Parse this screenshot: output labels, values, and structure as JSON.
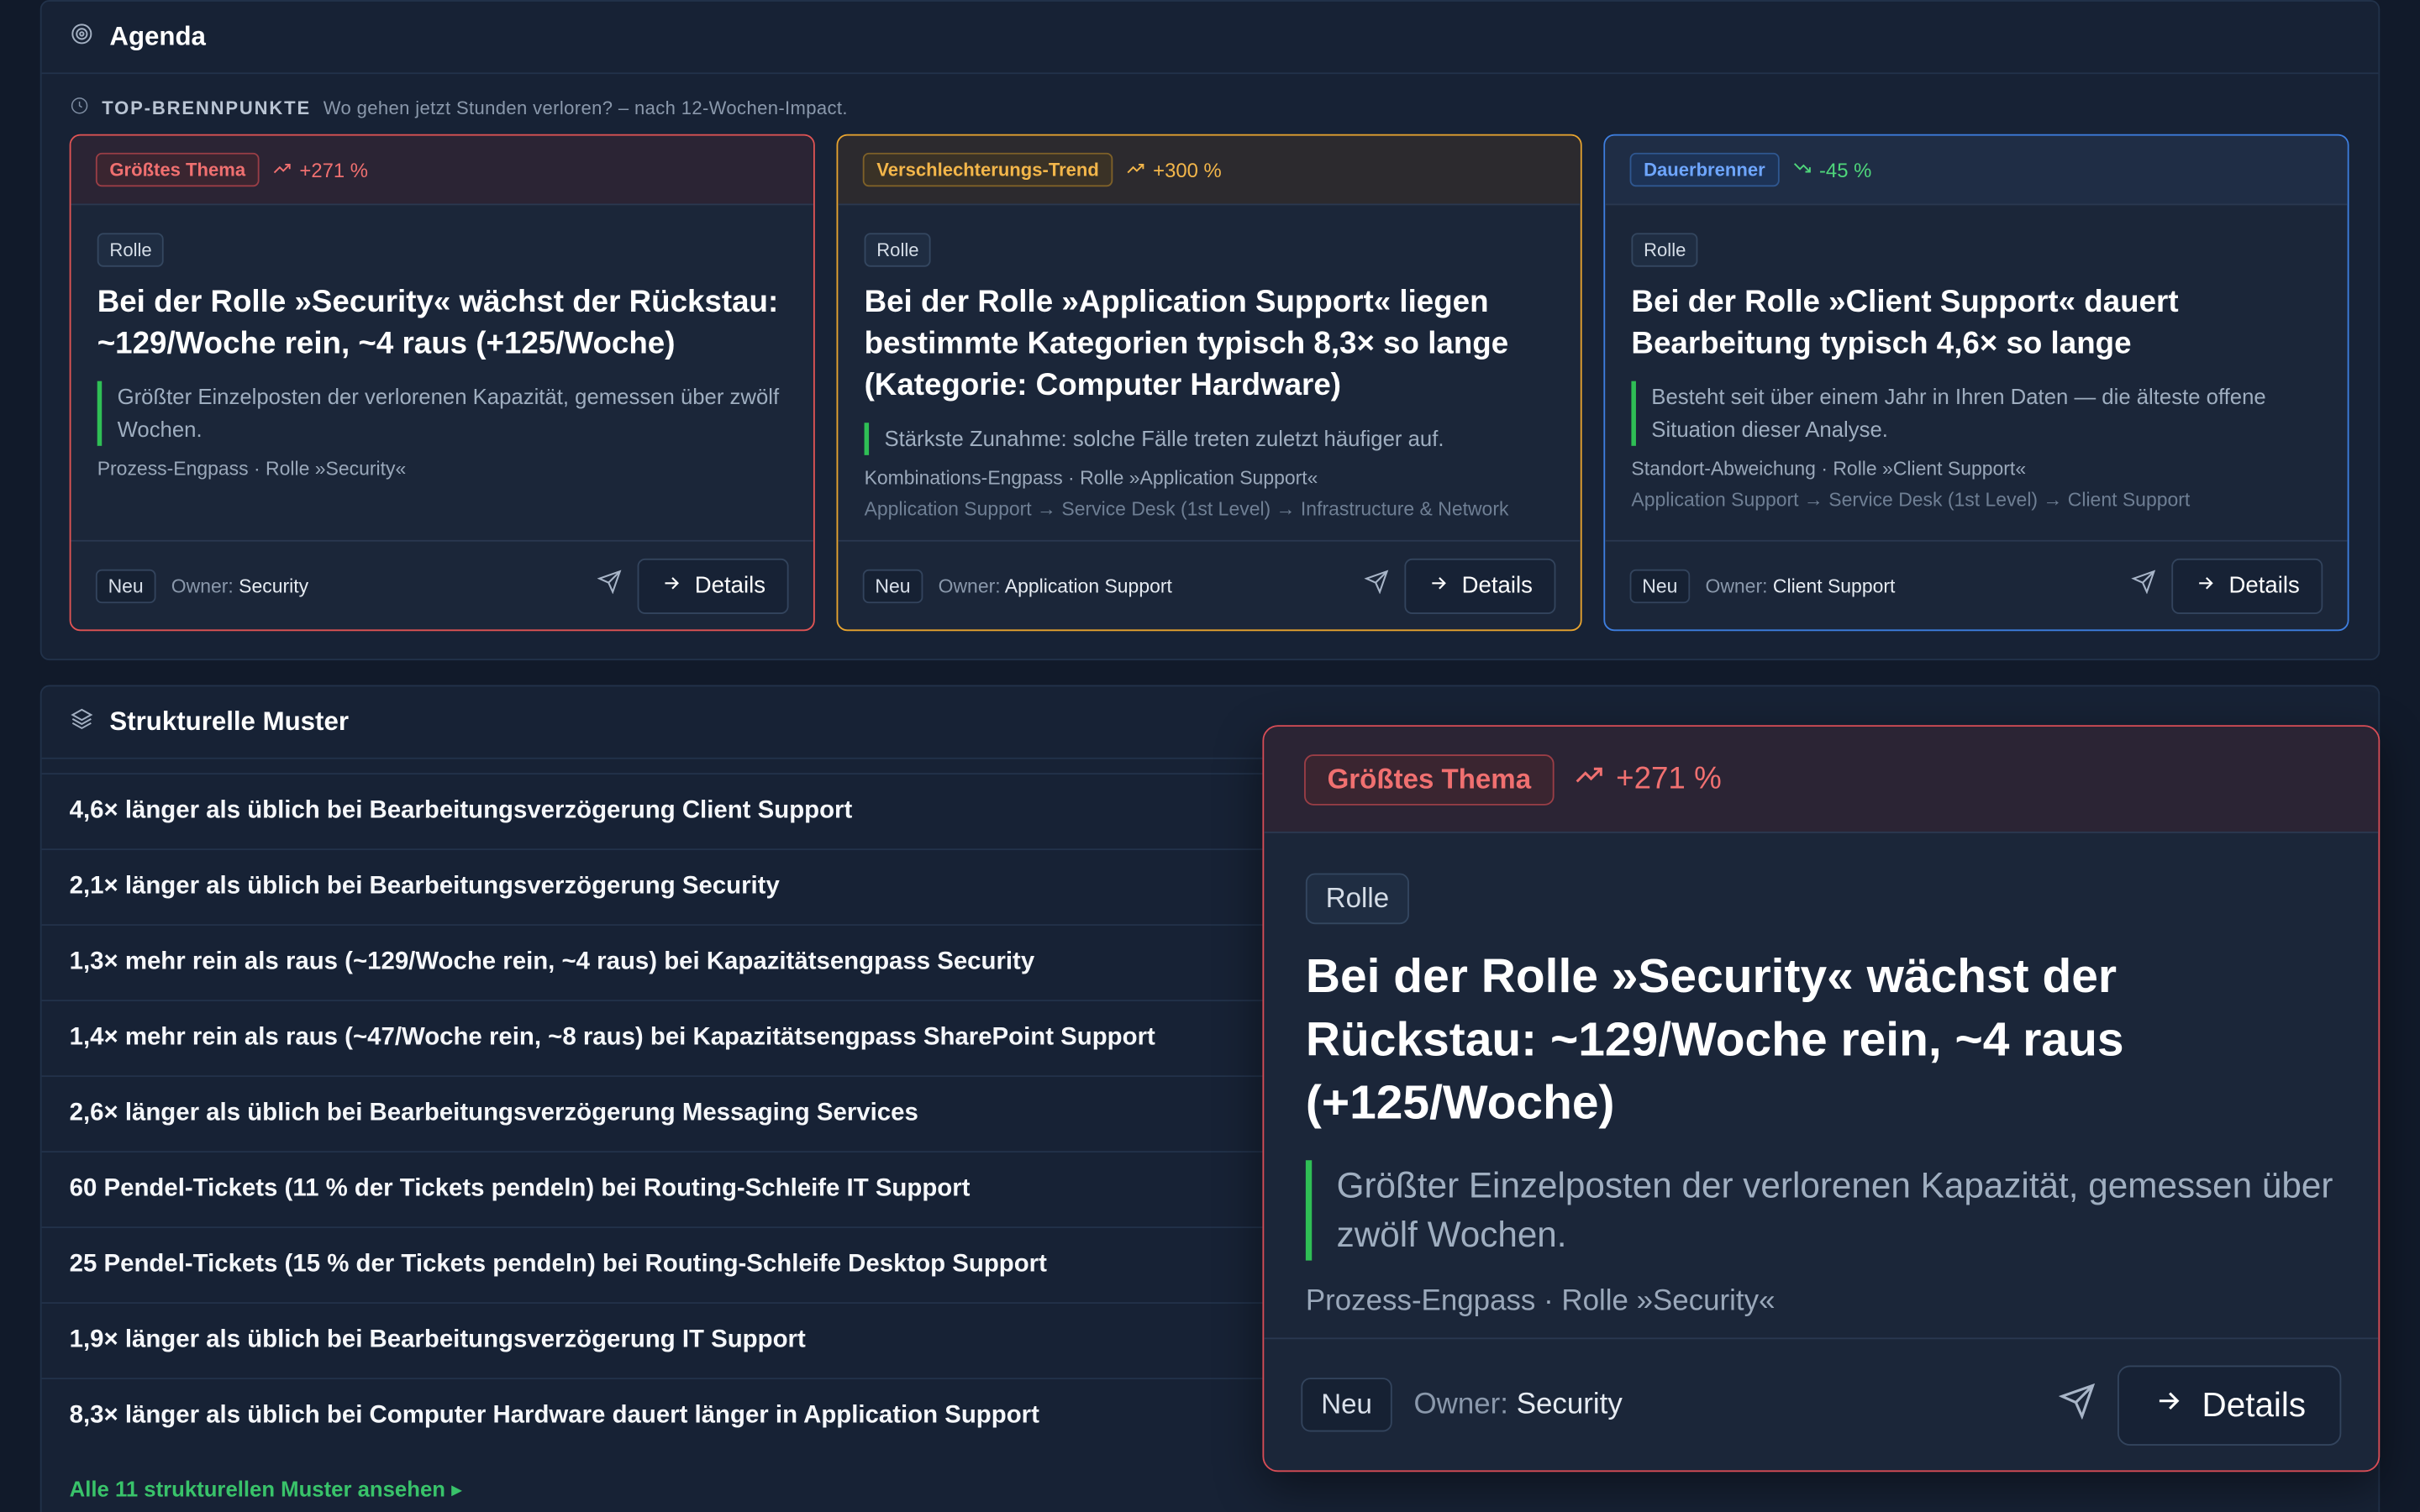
{
  "agenda": {
    "title": "Agenda",
    "subline_label": "TOP-BRENNPUNKTE",
    "subline_text": "Wo gehen jetzt Stunden verloren? – nach 12-Wochen-Impact.",
    "cards": [
      {
        "tag": "Größtes Thema",
        "trend": "+271 %",
        "pill": "Rolle",
        "title": "Bei der Rolle »Security« wächst der Rückstau: ~129/Woche rein, ~4 raus (+125/Woche)",
        "quote": "Größter Einzelposten der verlorenen Kapazität, gemessen über zwölf Wochen.",
        "meta": "Prozess-Engpass · Rolle »Security«",
        "meta2": "",
        "status": "Neu",
        "owner_label": "Owner:",
        "owner": "Security",
        "details": "Details"
      },
      {
        "tag": "Verschlechterungs-Trend",
        "trend": "+300 %",
        "pill": "Rolle",
        "title": "Bei der Rolle »Application Support« liegen bestimmte Kategorien typisch 8,3× so lange (Kategorie: Computer Hardware)",
        "quote": "Stärkste Zunahme: solche Fälle treten zuletzt häufiger auf.",
        "meta": "Kombinations-Engpass · Rolle »Application Support«",
        "meta2": "Application Support → Service Desk (1st Level) → Infrastructure & Network",
        "status": "Neu",
        "owner_label": "Owner:",
        "owner": "Application Support",
        "details": "Details"
      },
      {
        "tag": "Dauerbrenner",
        "trend": "-45 %",
        "pill": "Rolle",
        "title": "Bei der Rolle »Client Support« dauert Bearbeitung typisch 4,6× so lange",
        "quote": "Besteht seit über einem Jahr in Ihren Daten — die älteste offene Situation dieser Analyse.",
        "meta": "Standort-Abweichung · Rolle »Client Support«",
        "meta2": "Application Support → Service Desk (1st Level) → Client Support",
        "status": "Neu",
        "owner_label": "Owner:",
        "owner": "Client Support",
        "details": "Details"
      }
    ]
  },
  "patterns": {
    "title": "Strukturelle Muster",
    "rows": [
      "4,6× länger als üblich bei Bearbeitungsverzögerung Client Support",
      "2,1× länger als üblich bei Bearbeitungsverzögerung Security",
      "1,3× mehr rein als raus (~129/Woche rein, ~4 raus) bei Kapazitätsengpass Security",
      "1,4× mehr rein als raus (~47/Woche rein, ~8 raus) bei Kapazitätsengpass SharePoint Support",
      "2,6× länger als üblich bei Bearbeitungsverzögerung Messaging Services",
      "60 Pendel-Tickets (11 % der Tickets pendeln) bei Routing-Schleife IT Support",
      "25 Pendel-Tickets (15 % der Tickets pendeln) bei Routing-Schleife Desktop Support",
      "1,9× länger als üblich bei Bearbeitungsverzögerung IT Support",
      "8,3× länger als üblich bei Computer Hardware dauert länger in Application Support"
    ],
    "link": "Alle 11 strukturellen Muster ansehen ▸"
  },
  "overlay": {
    "tag": "Größtes Thema",
    "trend": "+271 %",
    "pill": "Rolle",
    "title": "Bei der Rolle »Security« wächst der Rückstau: ~129/Woche rein, ~4 raus (+125/Woche)",
    "quote": "Größter Einzelposten der verlorenen Kapazität, gemessen über zwölf Wochen.",
    "meta": "Prozess-Engpass · Rolle »Security«",
    "status": "Neu",
    "owner_label": "Owner:",
    "owner": "Security",
    "details": "Details"
  },
  "colors": {
    "background": "#111a2a",
    "panel": "#172235",
    "red": "#e05454",
    "orange": "#e8a42f",
    "blue": "#3e7fe0",
    "green": "#3fcf6f"
  },
  "icons": {
    "agenda": "target-icon",
    "subline": "clock-icon",
    "trend_up": "trend-up-icon",
    "trend_down": "trend-down-icon",
    "send": "send-icon",
    "arrow": "arrow-right-icon",
    "patterns": "layers-icon"
  }
}
